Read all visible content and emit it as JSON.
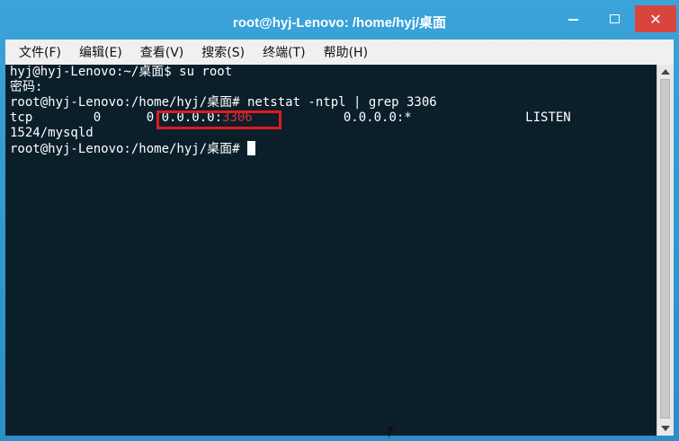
{
  "window": {
    "title": "root@hyj-Lenovo: /home/hyj/桌面",
    "controls": {
      "minimize": "minimize",
      "maximize": "maximize",
      "close": "✕"
    }
  },
  "menu": [
    "文件(F)",
    "编辑(E)",
    "查看(V)",
    "搜索(S)",
    "终端(T)",
    "帮助(H)"
  ],
  "terminal": {
    "line1": "hyj@hyj-Lenovo:~/桌面$ su root",
    "line2": "密码:",
    "line3": "root@hyj-Lenovo:/home/hyj/桌面# netstat -ntpl | grep 3306",
    "line4_a": "tcp        0      0 0.0.0.0:",
    "line4_port": "3306",
    "line4_b": "            0.0.0.0:*               LISTEN",
    "line5": "1524/mysqld",
    "line6": "root@hyj-Lenovo:/home/hyj/桌面# "
  },
  "colors": {
    "terminal_bg": "#0b1f2b",
    "highlight": "#e01a22",
    "close_button": "#d9453c"
  }
}
